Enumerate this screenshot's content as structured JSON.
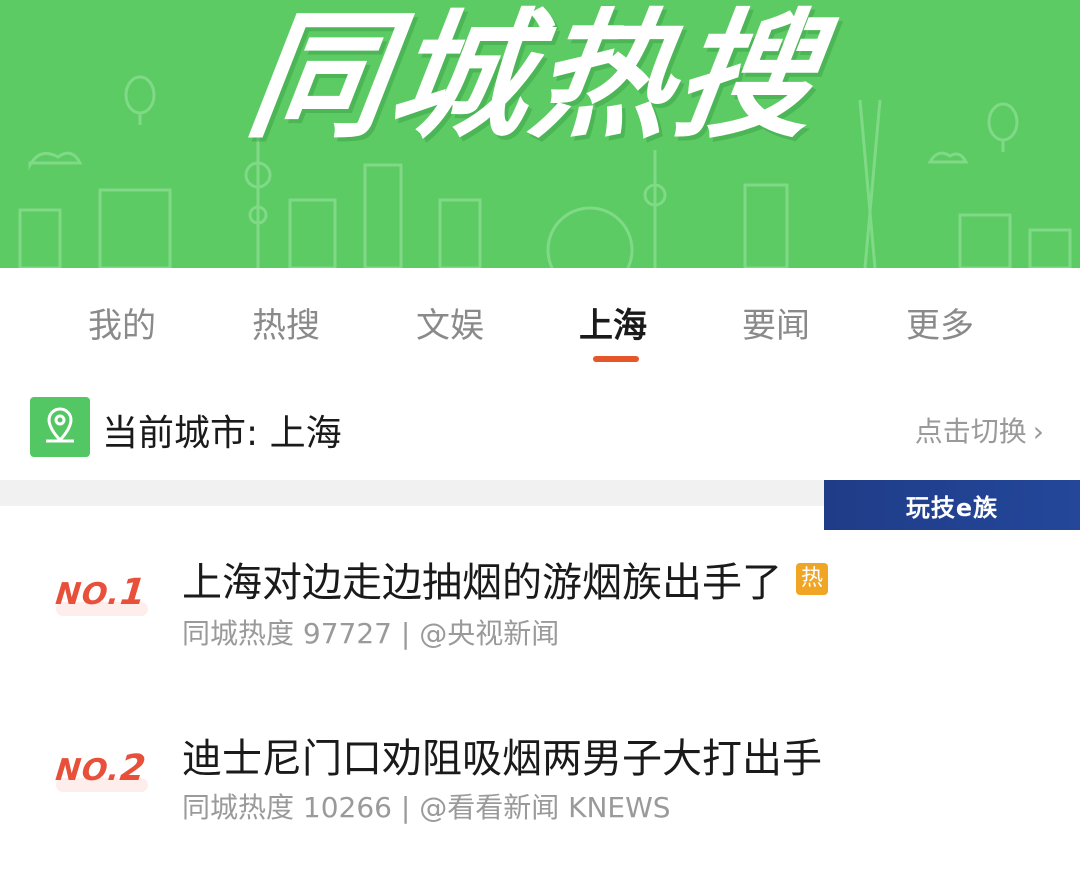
{
  "banner": {
    "title": "同城热搜"
  },
  "tabs": [
    {
      "label": "我的",
      "active": false
    },
    {
      "label": "热搜",
      "active": false
    },
    {
      "label": "文娱",
      "active": false
    },
    {
      "label": "上海",
      "active": true
    },
    {
      "label": "要闻",
      "active": false
    },
    {
      "label": "更多",
      "active": false
    }
  ],
  "city": {
    "label": "当前城市: 上海",
    "switch_label": "点击切换",
    "chevron": "›"
  },
  "watermark": "玩技e族",
  "list": [
    {
      "rank_prefix": "NO.",
      "rank_num": "1",
      "title": "上海对边走边抽烟的游烟族出手了",
      "badge": "热",
      "meta": "同城热度 97727 | @央视新闻"
    },
    {
      "rank_prefix": "NO.",
      "rank_num": "2",
      "title": "迪士尼门口劝阻吸烟两男子大打出手",
      "meta": "同城热度 10266 | @看看新闻 KNEWS"
    }
  ],
  "colors": {
    "banner": "#5ccb63",
    "accent": "#e5562b",
    "rank": "#e8503a",
    "hot_badge": "#f1a525"
  }
}
